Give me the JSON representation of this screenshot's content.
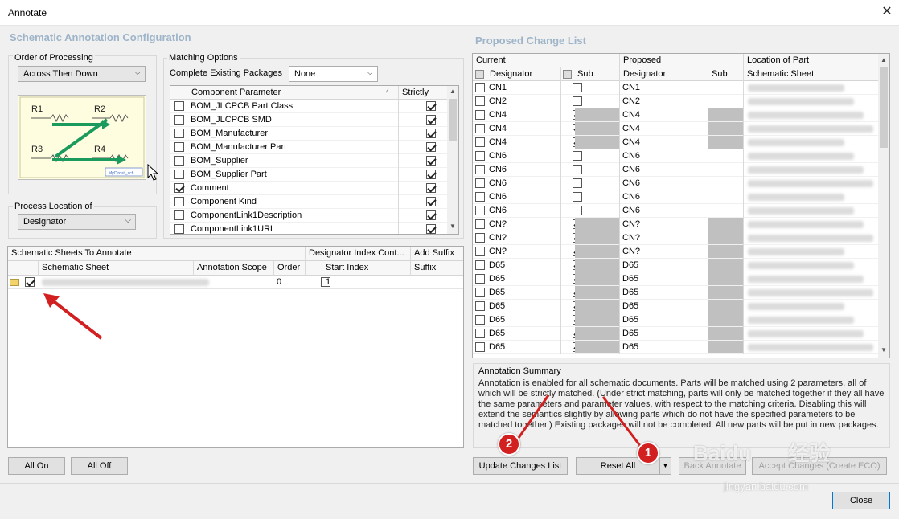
{
  "window": {
    "title": "Annotate",
    "close_icon": "close-icon"
  },
  "left": {
    "section_title": "Schematic Annotation Configuration",
    "order_label": "Order of Processing",
    "order_value": "Across Then Down",
    "diagram": {
      "r1": "R1",
      "r2": "R2",
      "r3": "R3",
      "r4": "R4",
      "caption": "MyCircuit_sch"
    },
    "process_label": "Process Location of",
    "process_value": "Designator",
    "matching_label": "Matching Options",
    "complete_label": "Complete Existing Packages",
    "complete_value": "None",
    "param_headers": {
      "parameter": "Component Parameter",
      "strictly": "Strictly"
    },
    "params": [
      {
        "name": "BOM_JLCPCB Part Class",
        "checked": false,
        "strict": true
      },
      {
        "name": "BOM_JLCPCB SMD",
        "checked": false,
        "strict": true
      },
      {
        "name": "BOM_Manufacturer",
        "checked": false,
        "strict": true
      },
      {
        "name": "BOM_Manufacturer Part",
        "checked": false,
        "strict": true
      },
      {
        "name": "BOM_Supplier",
        "checked": false,
        "strict": true
      },
      {
        "name": "BOM_Supplier Part",
        "checked": false,
        "strict": true
      },
      {
        "name": "Comment",
        "checked": true,
        "strict": true
      },
      {
        "name": "Component Kind",
        "checked": false,
        "strict": true
      },
      {
        "name": "ComponentLink1Description",
        "checked": false,
        "strict": true
      },
      {
        "name": "ComponentLink1URL",
        "checked": false,
        "strict": true
      }
    ],
    "sheets_table": {
      "group_header": "Schematic Sheets To Annotate",
      "designator_header": "Designator Index Cont...",
      "suffix_group": "Add Suffix",
      "col_sheet": "Schematic Sheet",
      "col_scope": "Annotation Scope",
      "col_order": "Order",
      "col_start": "Start Index",
      "col_suffix": "Suffix",
      "row": {
        "order": "0",
        "start": "1"
      }
    },
    "all_on": "All On",
    "all_off": "All Off"
  },
  "right": {
    "section_title": "Proposed Change List",
    "headers": {
      "current": "Current",
      "proposed": "Proposed",
      "location": "Location of Part",
      "designator": "Designator",
      "sub": "Sub",
      "sheet": "Schematic Sheet",
      "lock_icon": "lock-icon"
    },
    "rows": [
      {
        "cur": "CN1",
        "sub": false,
        "prop": "CN1",
        "shade": false
      },
      {
        "cur": "CN2",
        "sub": false,
        "prop": "CN2",
        "shade": false
      },
      {
        "cur": "CN4",
        "sub": true,
        "prop": "CN4",
        "shade": true
      },
      {
        "cur": "CN4",
        "sub": true,
        "prop": "CN4",
        "shade": true
      },
      {
        "cur": "CN4",
        "sub": true,
        "prop": "CN4",
        "shade": true
      },
      {
        "cur": "CN6",
        "sub": false,
        "prop": "CN6",
        "shade": false
      },
      {
        "cur": "CN6",
        "sub": false,
        "prop": "CN6",
        "shade": false
      },
      {
        "cur": "CN6",
        "sub": false,
        "prop": "CN6",
        "shade": false
      },
      {
        "cur": "CN6",
        "sub": false,
        "prop": "CN6",
        "shade": false
      },
      {
        "cur": "CN6",
        "sub": false,
        "prop": "CN6",
        "shade": false
      },
      {
        "cur": "CN?",
        "sub": true,
        "prop": "CN?",
        "shade": true
      },
      {
        "cur": "CN?",
        "sub": true,
        "prop": "CN?",
        "shade": true
      },
      {
        "cur": "CN?",
        "sub": true,
        "prop": "CN?",
        "shade": true
      },
      {
        "cur": "D65",
        "sub": true,
        "prop": "D65",
        "shade": true
      },
      {
        "cur": "D65",
        "sub": true,
        "prop": "D65",
        "shade": true
      },
      {
        "cur": "D65",
        "sub": true,
        "prop": "D65",
        "shade": true
      },
      {
        "cur": "D65",
        "sub": true,
        "prop": "D65",
        "shade": true
      },
      {
        "cur": "D65",
        "sub": true,
        "prop": "D65",
        "shade": true
      },
      {
        "cur": "D65",
        "sub": true,
        "prop": "D65",
        "shade": true
      },
      {
        "cur": "D65",
        "sub": true,
        "prop": "D65",
        "shade": true
      }
    ],
    "summary_title": "Annotation Summary",
    "summary_text": "Annotation is enabled for all schematic documents. Parts will be matched using 2 parameters, all of which will be strictly matched. (Under strict matching, parts will only be matched together if they all have the same parameters and parameter values, with respect to the matching criteria. Disabling this will extend the semantics slightly by allowing parts which do not have the specified parameters to be matched together.) Existing packages will not be completed. All new parts will be put in new packages.",
    "update_btn": "Update Changes List",
    "reset_btn": "Reset All",
    "back_btn": "Back Annotate",
    "accept_btn": "Accept Changes (Create ECO)"
  },
  "close_btn": "Close",
  "badges": {
    "one": "1",
    "two": "2"
  },
  "watermark": {
    "brand": "Baidu",
    "cn": "经验",
    "url": "jingyan.baidu.com"
  },
  "colors": {
    "section": "#9db4c9",
    "arrow_green": "#1a9a5c",
    "annotation_red": "#d21f1f"
  }
}
